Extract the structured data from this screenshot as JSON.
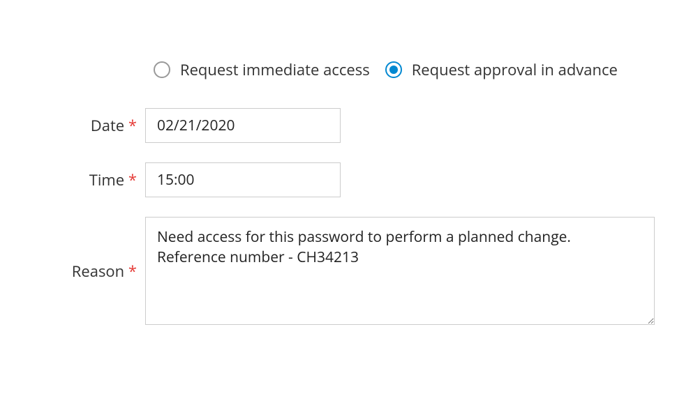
{
  "radios": {
    "immediate_label": "Request immediate access",
    "advance_label": "Request approval in advance",
    "selected": "advance"
  },
  "fields": {
    "date": {
      "label": "Date",
      "required_mark": "*",
      "value": "02/21/2020"
    },
    "time": {
      "label": "Time",
      "required_mark": "*",
      "value": "15:00"
    },
    "reason": {
      "label": "Reason",
      "required_mark": "*",
      "value": "Need access for this password to perform a planned change. Reference number - CH34213"
    }
  }
}
